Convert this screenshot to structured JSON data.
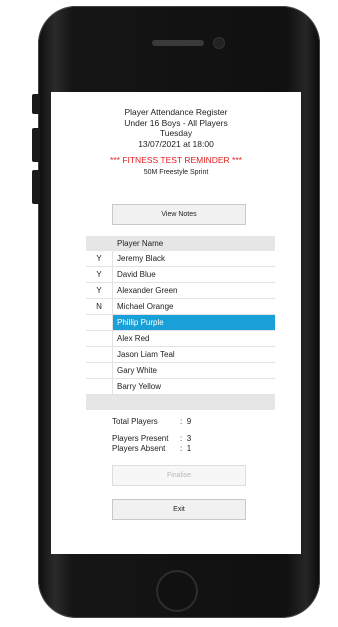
{
  "header": {
    "title": "Player Attendance Register",
    "group": "Under 16 Boys - All Players",
    "day": "Tuesday",
    "datetime": "13/07/2021 at 18:00"
  },
  "reminder": "*** FITNESS TEST REMINDER ***",
  "reminder_detail": "50M Freestyle Sprint",
  "view_notes_label": "View Notes",
  "table": {
    "column_header": "Player Name",
    "rows": [
      {
        "status": "Y",
        "name": "Jeremy Black"
      },
      {
        "status": "Y",
        "name": "David Blue"
      },
      {
        "status": "Y",
        "name": "Alexander Green"
      },
      {
        "status": "N",
        "name": "Michael Orange"
      },
      {
        "status": "",
        "name": "Phillip Purple",
        "selected": true
      },
      {
        "status": "",
        "name": "Alex Red"
      },
      {
        "status": "",
        "name": "Jason Liam Teal"
      },
      {
        "status": "",
        "name": "Gary White"
      },
      {
        "status": "",
        "name": "Barry Yellow"
      }
    ]
  },
  "summary": {
    "total_label": "Total Players",
    "total_value": "9",
    "present_label": "Players Present",
    "present_value": "3",
    "absent_label": "Players Absent",
    "absent_value": "1",
    "separator": ":"
  },
  "finalise_label": "Finalise",
  "exit_label": "Exit",
  "colors": {
    "selected_row": "#1aa0d8",
    "reminder": "#e02020"
  }
}
